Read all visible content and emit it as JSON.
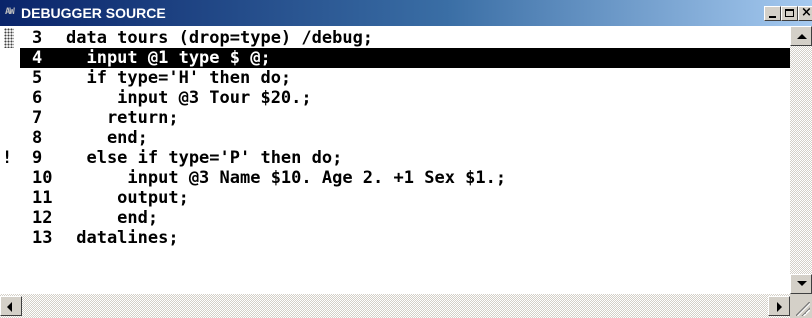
{
  "window": {
    "title": "DEBUGGER SOURCE",
    "icon": "sas-debugger-icon",
    "icon_text": "AW",
    "controls": {
      "minimize": "minimize",
      "maximize": "maximize",
      "close": "×"
    }
  },
  "source": {
    "current_line": 4,
    "breakpoint_marker": "!",
    "lines": [
      {
        "num": "3",
        "code": "data tours (drop=type) /debug;",
        "marker": "gutter"
      },
      {
        "num": "4",
        "code": "  input @1 type $ @;",
        "marker": "current"
      },
      {
        "num": "5",
        "code": "  if type='H' then do;",
        "marker": ""
      },
      {
        "num": "6",
        "code": "     input @3 Tour $20.;",
        "marker": ""
      },
      {
        "num": "7",
        "code": "    return;",
        "marker": ""
      },
      {
        "num": "8",
        "code": "    end;",
        "marker": ""
      },
      {
        "num": "9",
        "code": "  else if type='P' then do;",
        "marker": "breakpoint"
      },
      {
        "num": "10",
        "code": "      input @3 Name $10. Age 2. +1 Sex $1.;",
        "marker": ""
      },
      {
        "num": "11",
        "code": "     output;",
        "marker": ""
      },
      {
        "num": "12",
        "code": "     end;",
        "marker": ""
      },
      {
        "num": "13",
        "code": " datalines;",
        "marker": ""
      }
    ]
  },
  "colors": {
    "titlebar_start": "#0a246a",
    "titlebar_end": "#a6caf0",
    "highlight": "#000000",
    "window_face": "#d4d0c8"
  }
}
